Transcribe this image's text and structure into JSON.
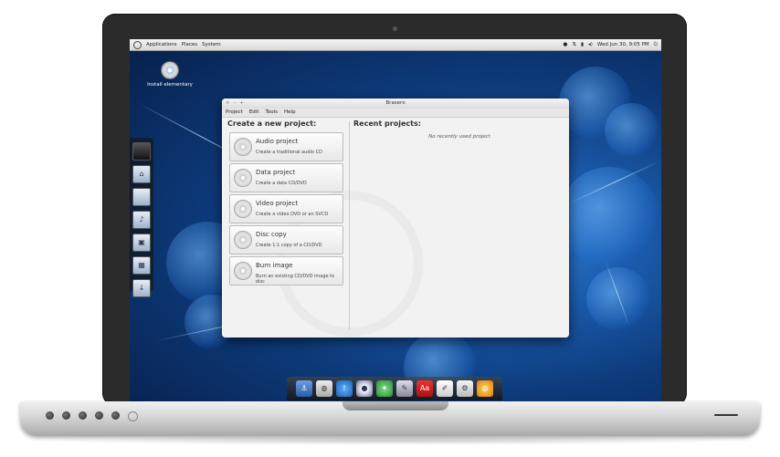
{
  "panel": {
    "menus": [
      "Applications",
      "Places",
      "System"
    ],
    "clock": "Wed Jun 30,  9:05 PM"
  },
  "desktop": {
    "install_icon_label": "Install elementary"
  },
  "window": {
    "title": "Brasero",
    "controls": [
      "×",
      "–",
      "+"
    ],
    "menu": [
      "Project",
      "Edit",
      "Tools",
      "Help"
    ],
    "create_heading": "Create a new project:",
    "recent_heading": "Recent projects:",
    "no_recent": "No recently used project",
    "projects": [
      {
        "name": "Audio project",
        "desc": "Create a traditional audio CD",
        "icon": "music-note-icon"
      },
      {
        "name": "Data project",
        "desc": "Create a data CD/DVD",
        "icon": "data-disc-icon"
      },
      {
        "name": "Video project",
        "desc": "Create a video DVD or an SVCD",
        "icon": "film-icon"
      },
      {
        "name": "Disc copy",
        "desc": "Create 1:1 copy of a CD/DVD",
        "icon": "disc-copy-icon"
      },
      {
        "name": "Burn image",
        "desc": "Burn an existing CD/DVD image to disc",
        "icon": "burn-image-icon"
      }
    ]
  },
  "colors": {
    "wallpaper_dark": "#071f4a",
    "wallpaper_light": "#2f7fd6",
    "window_bg": "#efefef"
  }
}
